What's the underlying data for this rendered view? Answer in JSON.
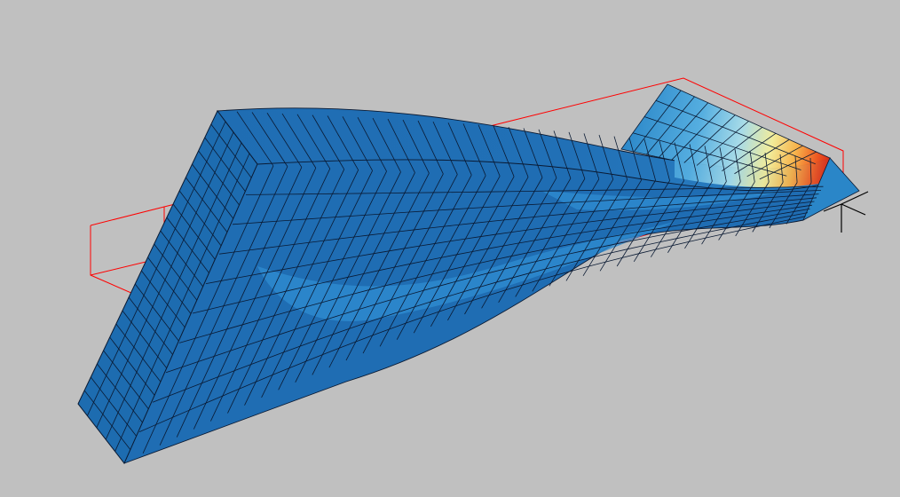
{
  "viewport": {
    "background_color": "#c0c0c0",
    "content": "fea-deformed-mesh-contour-plot"
  },
  "model": {
    "mesh_line_color": "#0a1a33",
    "bounding_box_color": "#ff0000",
    "contour_colors": [
      "#1f6db3",
      "#2a86c8",
      "#55aee0",
      "#a7dbe8",
      "#f2ec9a",
      "#f7b24a",
      "#ee5a22",
      "#d61c12"
    ],
    "triad_color": "#000000"
  }
}
